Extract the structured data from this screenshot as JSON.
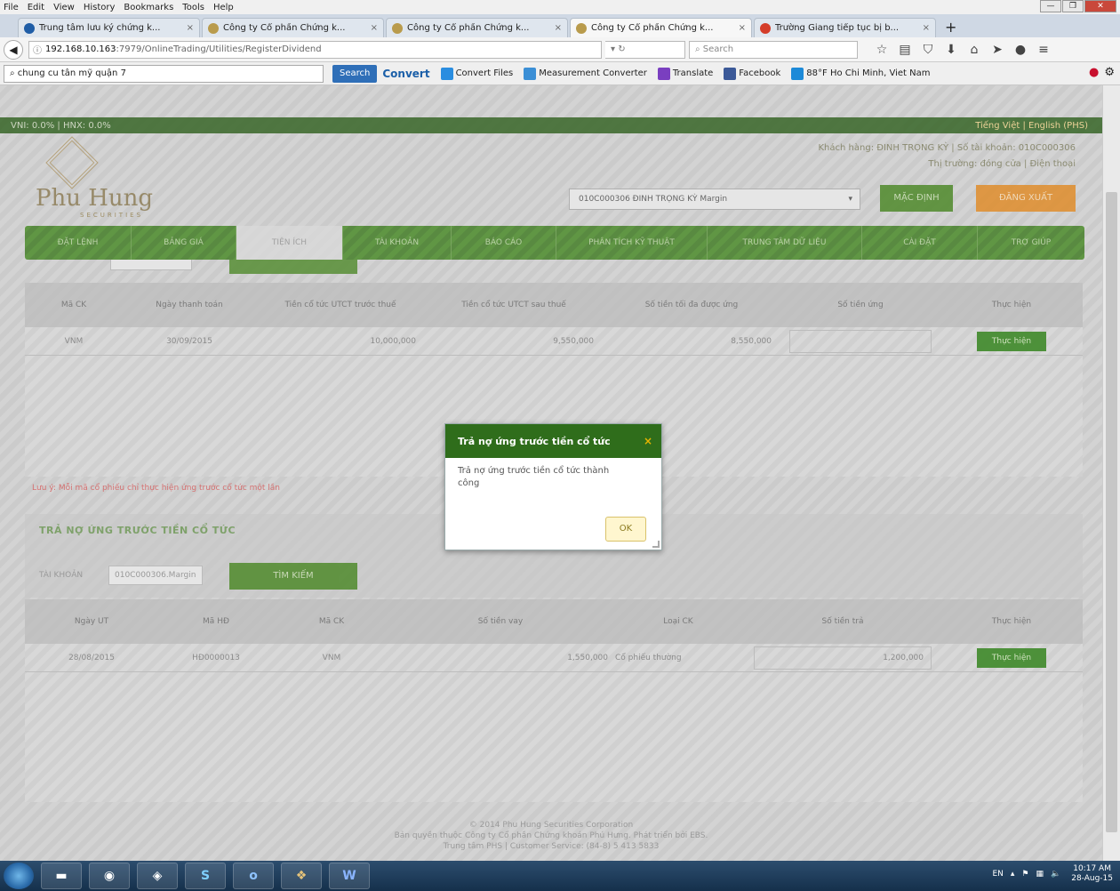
{
  "browser": {
    "menu": [
      "File",
      "Edit",
      "View",
      "History",
      "Bookmarks",
      "Tools",
      "Help"
    ],
    "tabs": [
      {
        "label": "Trung tâm lưu ký chứng k...",
        "active": false,
        "favicon": "#1f5da6"
      },
      {
        "label": "Công ty Cổ phần Chứng k...",
        "active": false,
        "favicon": "#b99b4c"
      },
      {
        "label": "Công ty Cổ phần Chứng k...",
        "active": false,
        "favicon": "#b99b4c"
      },
      {
        "label": "Công ty Cổ phần Chứng k...",
        "active": true,
        "favicon": "#b99b4c"
      },
      {
        "label": "Trường Giang tiếp tục bị b...",
        "active": false,
        "favicon": "#d43d2a"
      }
    ],
    "tab_close": "×",
    "new_tab": "+",
    "url_host": "192.168.10.163",
    "url_path": ":7979/OnlineTrading/Utilities/RegisterDividend",
    "search_placeholder": "Search",
    "toolbar_search_value": "chung cu tân mỹ quận 7",
    "toolbar_search_btn": "Search",
    "convert_label": "Convert",
    "toolbar_links": [
      {
        "label": "Convert Files",
        "color": "#2a8de0"
      },
      {
        "label": "Measurement Converter",
        "color": "#3b8fd6"
      },
      {
        "label": "Translate",
        "color": "#7a3fc0"
      },
      {
        "label": "Facebook",
        "color": "#3b5998"
      },
      {
        "label": "88°F Ho Chi Minh, Viet Nam",
        "color": "#1d8ad8"
      }
    ]
  },
  "page": {
    "top_strip": "VNI: 0.0%  |  HNX: 0.0%",
    "lang": "Tiếng Việt | English (PHS)",
    "logo_text": "Phu Hung",
    "logo_sub": "SECURITIES",
    "customer_line": "Khách hàng: ĐINH TRỌNG KỲ | Số tài khoản: 010C000306",
    "market_line": "Thị trường: đóng cửa | Điện thoại",
    "account_select": "010C000306 ĐINH TRỌNG KỲ Margin",
    "default_btn": "MẶC ĐỊNH",
    "logout_btn": "ĐĂNG XUẤT",
    "nav": [
      {
        "label": "ĐẶT LỆNH",
        "active": false
      },
      {
        "label": "BẢNG GIÁ",
        "active": false
      },
      {
        "label": "TIỆN ÍCH",
        "active": true
      },
      {
        "label": "TÀI KHOẢN",
        "active": false
      },
      {
        "label": "BÁO CÁO",
        "active": false
      },
      {
        "label": "PHÂN TÍCH KỸ THUẬT",
        "active": false
      },
      {
        "label": "TRUNG TÂM DỮ LIỆU",
        "active": false
      },
      {
        "label": "CÀI ĐẶT",
        "active": false
      },
      {
        "label": "TRỢ GIÚP",
        "active": false
      }
    ],
    "table1": {
      "headers": [
        "Mã CK",
        "Ngày thanh toán",
        "Tiền cổ tức UTCT trước thuế",
        "Tiền cổ tức UTCT sau thuế",
        "Số tiền tối đa được ứng",
        "Số tiền ứng",
        "Thực hiện"
      ],
      "row": [
        "VNM",
        "30/09/2015",
        "10,000,000",
        "9,550,000",
        "8,550,000",
        ""
      ],
      "action": "Thực hiện"
    },
    "note": "Lưu ý: Mỗi mã cổ phiếu chỉ thực hiện ứng trước cổ tức một lần",
    "section2_title": "TRẢ NỢ ỨNG TRƯỚC TIỀN CỔ TỨC",
    "section2_account_label": "TÀI KHOẢN",
    "section2_account_value": "010C000306.Margin",
    "section2_search": "TÌM KIẾM",
    "table2": {
      "headers": [
        "Ngày UT",
        "Mã HĐ",
        "Mã CK",
        "Số tiền vay",
        "Loại CK",
        "Số tiền trả",
        "Thực hiện"
      ],
      "row": [
        "28/08/2015",
        "HĐ0000013",
        "VNM",
        "1,550,000",
        "Cổ phiếu thường",
        "1,200,000"
      ],
      "action": "Thực hiện"
    },
    "footer": [
      "© 2014 Phu Hung Securities Corporation",
      "Bản quyền thuộc Công ty Cổ phần Chứng khoán Phú Hưng. Phát triển bởi EBS.",
      "Trung tâm PHS | Customer Service: (84-8) 5 413 5833"
    ]
  },
  "dialog": {
    "title": "Trả nợ ứng trước tiền cổ tức",
    "message": "Trả nợ ứng trước tiền cổ tức thành công",
    "ok": "OK",
    "close": "×"
  },
  "taskbar": {
    "apps": [
      "",
      "",
      "S",
      "o",
      "",
      "W"
    ],
    "lang": "EN",
    "time": "10:17 AM",
    "date": "28-Aug-15"
  }
}
